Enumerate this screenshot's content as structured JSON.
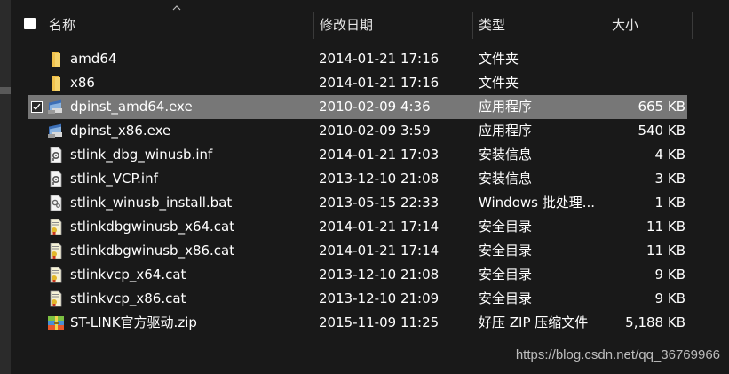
{
  "header": {
    "name_label": "名称",
    "date_label": "修改日期",
    "type_label": "类型",
    "size_label": "大小"
  },
  "files": [
    {
      "name": "amd64",
      "date": "2014-01-21 17:16",
      "type": "文件夹",
      "size": "",
      "icon": "folder-icon",
      "selected": false
    },
    {
      "name": "x86",
      "date": "2014-01-21 17:16",
      "type": "文件夹",
      "size": "",
      "icon": "folder-icon",
      "selected": false
    },
    {
      "name": "dpinst_amd64.exe",
      "date": "2010-02-09 4:36",
      "type": "应用程序",
      "size": "665 KB",
      "icon": "installer-exe-icon",
      "selected": true
    },
    {
      "name": "dpinst_x86.exe",
      "date": "2010-02-09 3:59",
      "type": "应用程序",
      "size": "540 KB",
      "icon": "installer-exe-icon",
      "selected": false
    },
    {
      "name": "stlink_dbg_winusb.inf",
      "date": "2014-01-21 17:03",
      "type": "安装信息",
      "size": "4 KB",
      "icon": "setup-info-icon",
      "selected": false
    },
    {
      "name": "stlink_VCP.inf",
      "date": "2013-12-10 21:08",
      "type": "安装信息",
      "size": "3 KB",
      "icon": "setup-info-icon",
      "selected": false
    },
    {
      "name": "stlink_winusb_install.bat",
      "date": "2013-05-15 22:33",
      "type": "Windows 批处理...",
      "size": "1 KB",
      "icon": "batch-file-icon",
      "selected": false
    },
    {
      "name": "stlinkdbgwinusb_x64.cat",
      "date": "2014-01-21 17:14",
      "type": "安全目录",
      "size": "11 KB",
      "icon": "security-catalog-icon",
      "selected": false
    },
    {
      "name": "stlinkdbgwinusb_x86.cat",
      "date": "2014-01-21 17:14",
      "type": "安全目录",
      "size": "11 KB",
      "icon": "security-catalog-icon",
      "selected": false
    },
    {
      "name": "stlinkvcp_x64.cat",
      "date": "2013-12-10 21:08",
      "type": "安全目录",
      "size": "9 KB",
      "icon": "security-catalog-icon",
      "selected": false
    },
    {
      "name": "stlinkvcp_x86.cat",
      "date": "2013-12-10 21:09",
      "type": "安全目录",
      "size": "9 KB",
      "icon": "security-catalog-icon",
      "selected": false
    },
    {
      "name": "ST-LINK官方驱动.zip",
      "date": "2015-11-09 11:25",
      "type": "好压 ZIP 压缩文件",
      "size": "5,188 KB",
      "icon": "zip-archive-icon",
      "selected": false
    }
  ],
  "watermark": "https://blog.csdn.net/qq_36769966",
  "colors": {
    "background": "#191919",
    "selected_row": "#777777",
    "folder": "#f1c24d",
    "text": "#ffffff"
  }
}
